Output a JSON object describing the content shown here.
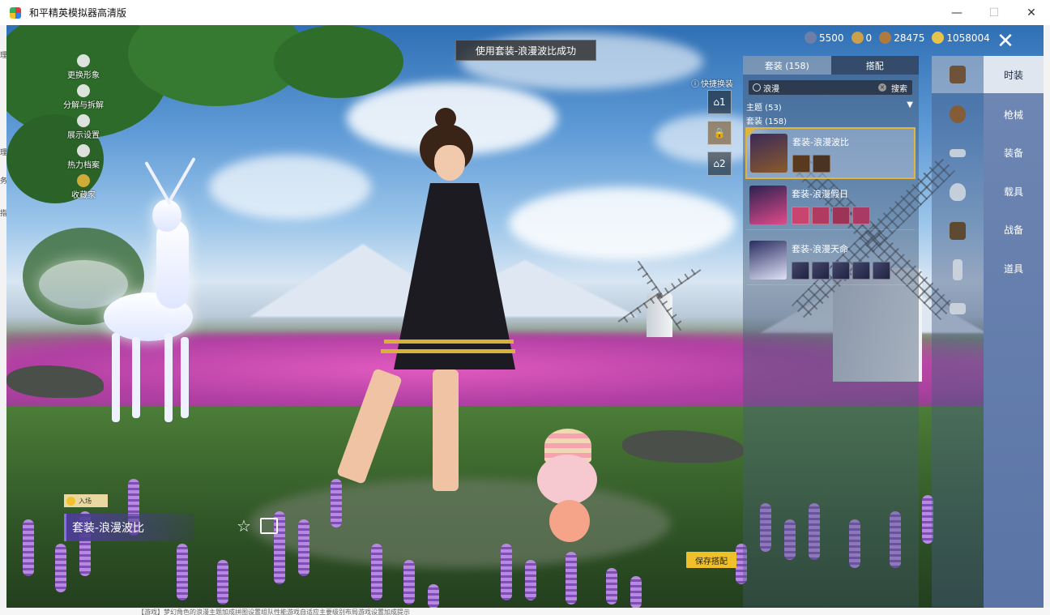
{
  "window": {
    "title": "和平精英模拟器高清版",
    "minimize_glyph": "—",
    "maximize_glyph": "☐",
    "close_glyph": "✕"
  },
  "notification": {
    "text": "使用套装-浪漫波比成功"
  },
  "currencies": [
    {
      "icon": "globe-coin-icon",
      "value": "5500",
      "color": "#6d7fa8"
    },
    {
      "icon": "a-coin-icon",
      "value": "0",
      "color": "#caa04a"
    },
    {
      "icon": "bronze-coin-icon",
      "value": "28475",
      "color": "#b07a3e"
    },
    {
      "icon": "gold-coin-icon",
      "value": "1058004",
      "color": "#e7c34a"
    }
  ],
  "left_menu": [
    {
      "label": "更换形象",
      "icon": "person-icon"
    },
    {
      "label": "分解与拆解",
      "icon": "puzzle-icon"
    },
    {
      "label": "展示设置",
      "icon": "eye-icon"
    },
    {
      "label": "热力档案",
      "icon": "flame-icon"
    },
    {
      "label": "收藏家",
      "icon": "collector-icon"
    }
  ],
  "quick_swap": {
    "title": "快捷换装",
    "slot1": "1",
    "slot2": "2"
  },
  "panel": {
    "tabs": [
      {
        "label": "套装 (158)"
      },
      {
        "label": "搭配"
      }
    ],
    "search": {
      "value": "浪漫",
      "button": "搜索"
    },
    "theme_label": "主题 (53)",
    "set_label": "套装 (158)",
    "cards": [
      {
        "name": "套装-浪漫波比",
        "pieces": 2
      },
      {
        "name": "套装-浪漫假日",
        "pieces": 4
      },
      {
        "name": "套装-浪漫天命",
        "pieces": 5
      }
    ]
  },
  "categories": [
    {
      "label": "时装"
    },
    {
      "label": "枪械"
    },
    {
      "label": "装备"
    },
    {
      "label": "载具"
    },
    {
      "label": "战备"
    },
    {
      "label": "道具"
    }
  ],
  "entry_badge": "入场",
  "current_outfit": "套装-浪漫波比",
  "save_button": "保存搭配",
  "left_strip": [
    "理",
    "理",
    "务",
    "指"
  ],
  "background_text": "【游戏】梦幻角色的浪漫主题加成拼图设置组队性能游戏自适应主要级别布局游戏设置加成提示"
}
